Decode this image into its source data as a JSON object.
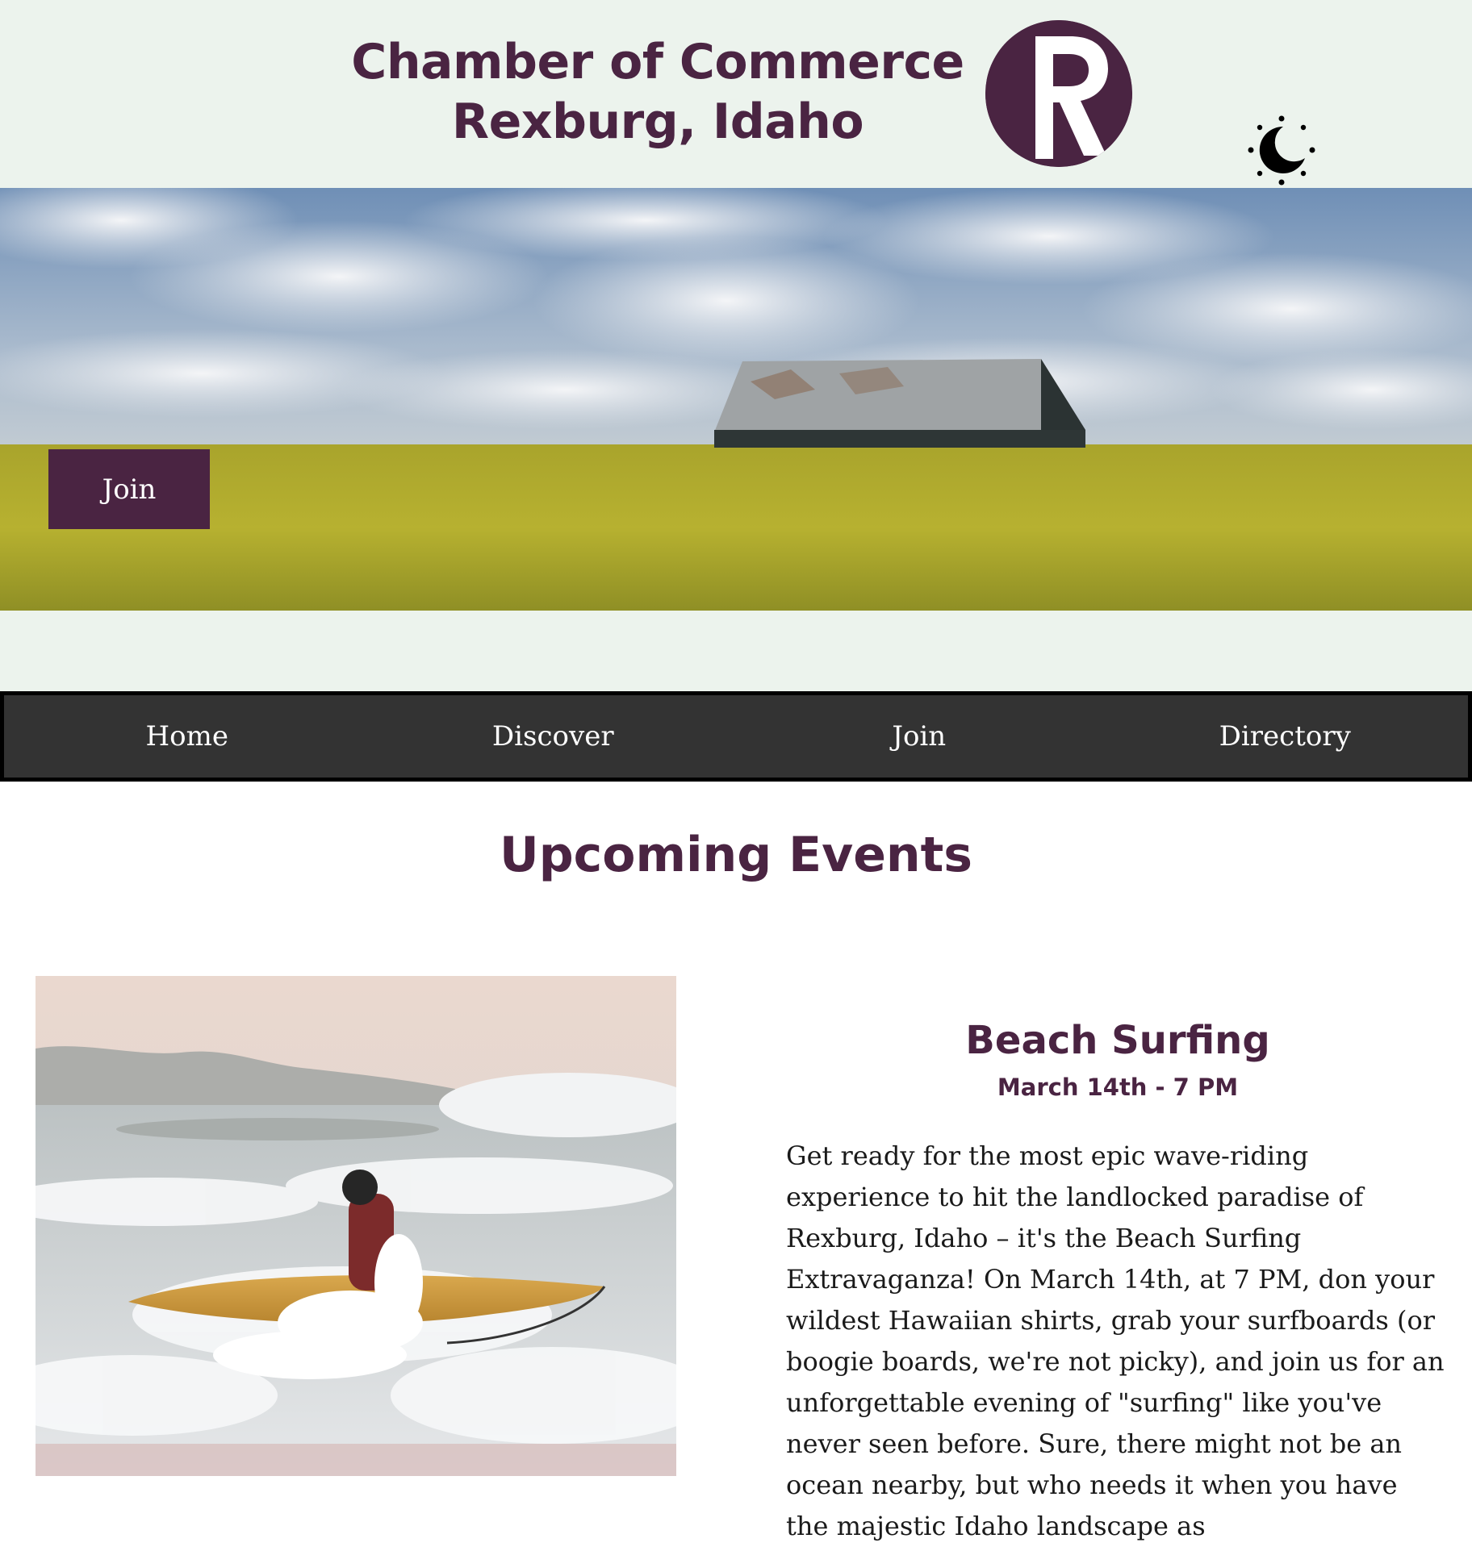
{
  "header": {
    "title_line1": "Chamber of Commerce",
    "title_line2": "Rexburg, Idaho",
    "logo_letter": "R",
    "theme_icon": "moon-sun-icon"
  },
  "hero": {
    "join_label": "Join"
  },
  "nav": {
    "items": [
      {
        "label": "Home"
      },
      {
        "label": "Discover"
      },
      {
        "label": "Join"
      },
      {
        "label": "Directory"
      }
    ]
  },
  "events": {
    "heading": "Upcoming Events",
    "event": {
      "name": "Beach Surfing",
      "date": "March 14th - 7 PM",
      "description": "Get ready for the most epic wave-riding experience to hit the landlocked paradise of Rexburg, Idaho – it's the Beach Surfing Extravaganza! On March 14th, at 7 PM, don your wildest Hawaiian shirts, grab your surfboards (or boogie boards, we're not picky), and join us for an unforgettable evening of \"surfing\" like you've never seen before. Sure, there might not be an ocean nearby, but who needs it when you have the majestic Idaho landscape as"
    }
  },
  "colors": {
    "brand": "#4a2442",
    "header_bg": "#ecf3ed",
    "nav_bg": "#333333"
  }
}
